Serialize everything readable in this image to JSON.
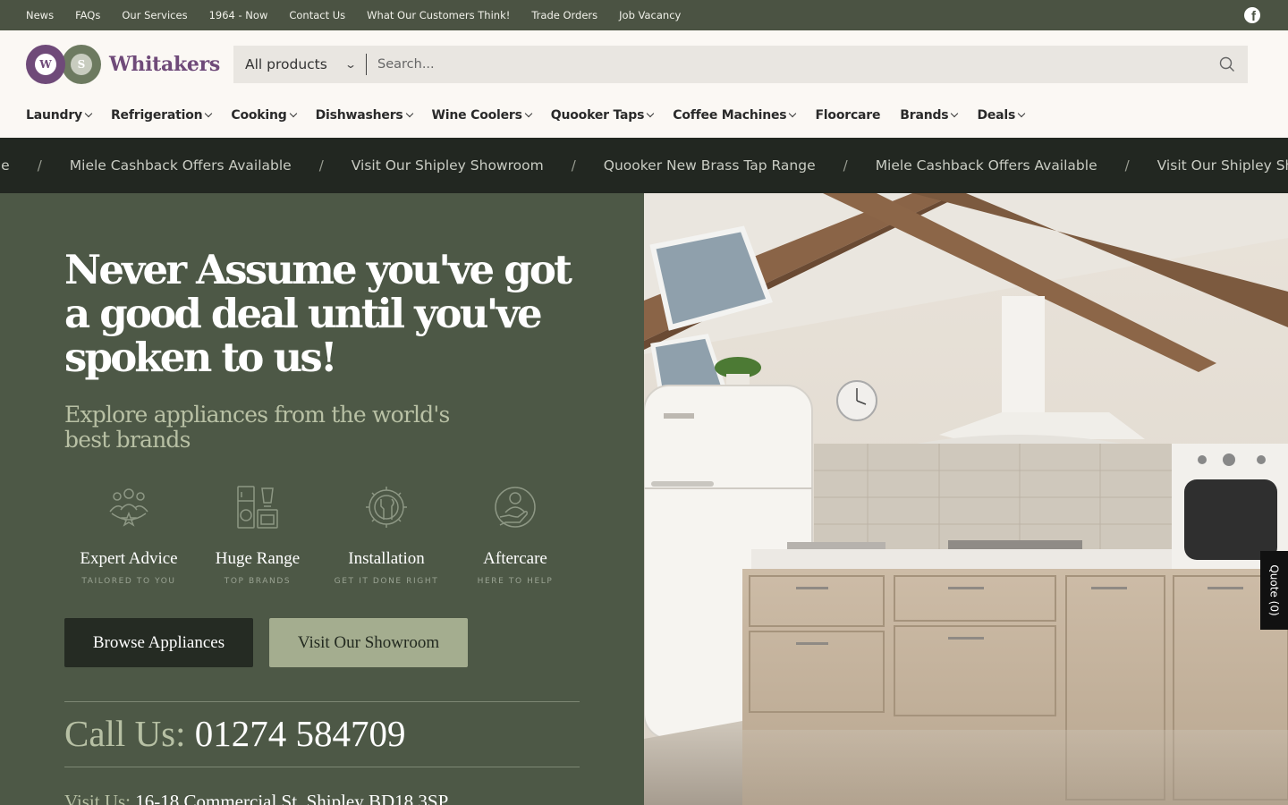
{
  "topbar": {
    "links": [
      "News",
      "FAQs",
      "Our Services",
      "1964 - Now",
      "Contact Us",
      "What Our Customers Think!",
      "Trade Orders",
      "Job Vacancy"
    ],
    "social_icon": "facebook-icon"
  },
  "header": {
    "logo_letters": [
      "W",
      "S"
    ],
    "brand": "Whitakers",
    "search": {
      "category": "All products",
      "placeholder": "Search..."
    },
    "nav": [
      {
        "label": "Laundry",
        "dropdown": true
      },
      {
        "label": "Refrigeration",
        "dropdown": true
      },
      {
        "label": "Cooking",
        "dropdown": true
      },
      {
        "label": "Dishwashers",
        "dropdown": true
      },
      {
        "label": "Wine Coolers",
        "dropdown": true
      },
      {
        "label": "Quooker Taps",
        "dropdown": true
      },
      {
        "label": "Coffee Machines",
        "dropdown": true
      },
      {
        "label": "Floorcare",
        "dropdown": false
      },
      {
        "label": "Brands",
        "dropdown": true
      },
      {
        "label": "Deals",
        "dropdown": true
      }
    ]
  },
  "marquee": {
    "items": [
      "ange",
      "Miele Cashback Offers Available",
      "Visit Our Shipley Showroom",
      "Quooker New Brass Tap Range",
      "Miele Cashback Offers Available",
      "Visit Our Shipley Showro"
    ],
    "separator": "/"
  },
  "hero": {
    "title": "Never Assume you've got a good deal until you've spoken to us!",
    "subtitle": "Explore appliances from the world's best brands",
    "features": [
      {
        "title": "Expert Advice",
        "sub": "TAILORED TO YOU",
        "icon": "team-icon"
      },
      {
        "title": "Huge Range",
        "sub": "TOP BRANDS",
        "icon": "appliances-icon"
      },
      {
        "title": "Installation",
        "sub": "GET IT DONE RIGHT",
        "icon": "tools-gear-icon"
      },
      {
        "title": "Aftercare",
        "sub": "HERE TO HELP",
        "icon": "care-hand-icon"
      }
    ],
    "buttons": {
      "browse": "Browse Appliances",
      "showroom": "Visit Our Showroom"
    },
    "call_label": "Call Us:",
    "phone": "01274 584709",
    "visit_label": "Visit Us:",
    "address": "16-18 Commercial St, Shipley BD18 3SP"
  },
  "quote_tab": "Quote (0)",
  "colors": {
    "topbar": "#4b5343",
    "hero_bg": "#4d5846",
    "brand_purple": "#6f4a79",
    "marquee_bg": "#222721"
  }
}
